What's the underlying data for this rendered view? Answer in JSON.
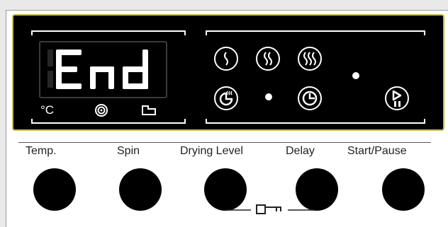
{
  "display": {
    "readout": "End",
    "units": {
      "temperature": "°C"
    },
    "indicators": [
      "temperature-unit",
      "spin-swirl",
      "timer-delay"
    ]
  },
  "drying_options": [
    "low-heat",
    "medium-heat",
    "high-heat"
  ],
  "modes": [
    "timed-dry",
    "delay-timer",
    "start-pause"
  ],
  "controls": {
    "temp_label": "Temp.",
    "spin_label": "Spin",
    "drying_level_label": "Drying Level",
    "delay_label": "Delay",
    "start_pause_label": "Start/Pause"
  },
  "colors": {
    "panel": "#000000",
    "panel_border": "#c9b74a",
    "indicator": "#ffffff",
    "segment_off": "#2a2a2a"
  }
}
